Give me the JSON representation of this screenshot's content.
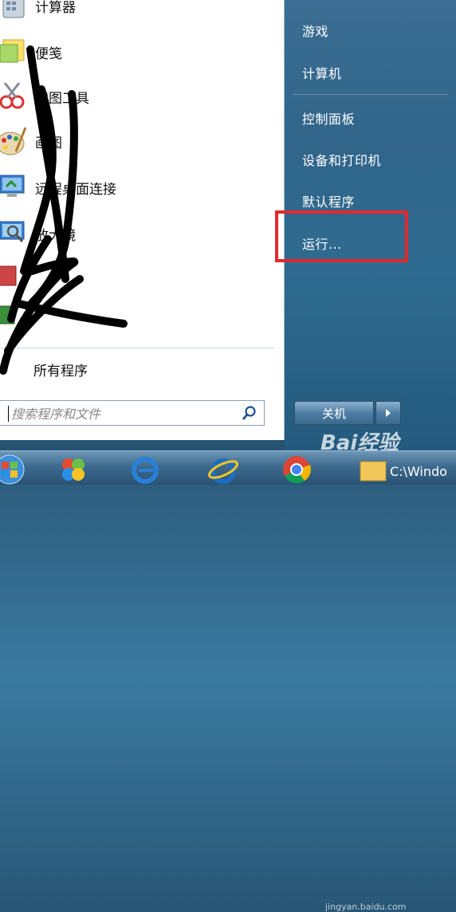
{
  "left_programs": [
    {
      "label": "计算器",
      "icon": "calculator-icon"
    },
    {
      "label": "便笺",
      "icon": "sticky-notes-icon"
    },
    {
      "label": "截图工具",
      "icon": "snipping-tool-icon"
    },
    {
      "label": "画图",
      "icon": "paint-icon"
    },
    {
      "label": "远程桌面连接",
      "icon": "remote-desktop-icon"
    },
    {
      "label": "放大镜",
      "icon": "magnifier-icon"
    }
  ],
  "all_programs_label": "所有程序",
  "search": {
    "placeholder": "搜索程序和文件"
  },
  "right_items": [
    {
      "label": "游戏"
    },
    {
      "label": "计算机"
    },
    {
      "label": "控制面板"
    },
    {
      "label": "设备和打印机"
    },
    {
      "label": "默认程序"
    },
    {
      "label": "运行..."
    }
  ],
  "shutdown_label": "关机",
  "taskbar": {
    "path_text": "C:\\Windo"
  },
  "watermark": {
    "brand": "Bai经验",
    "sub": "jingyan.baidu.com"
  },
  "colors": {
    "highlight": "#e02a2a",
    "right_pane": "#31658a",
    "taskbar": "#3d6a8e"
  }
}
